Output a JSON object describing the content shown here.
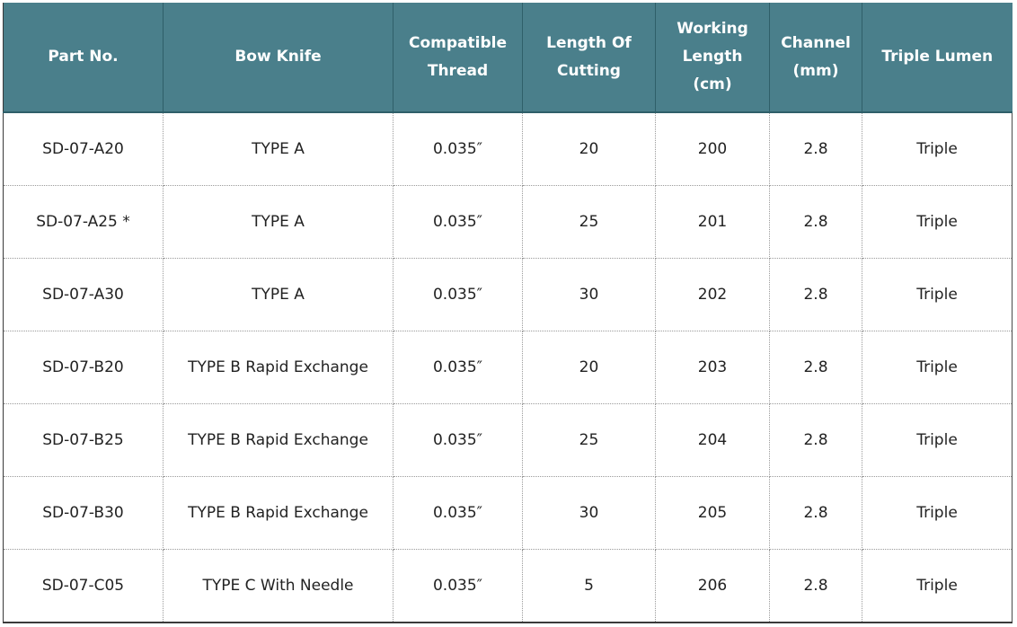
{
  "headers": [
    "Part No.",
    "Bow Knife",
    "Compatible Thread",
    "Length Of Cutting",
    "Working Length (cm)",
    "Channel (mm)",
    "Triple Lumen"
  ],
  "rows": [
    [
      "SD-07-A20",
      "TYPE A",
      "0.035″",
      "20",
      "200",
      "2.8",
      "Triple"
    ],
    [
      "SD-07-A25 *",
      "TYPE A",
      "0.035″",
      "25",
      "201",
      "2.8",
      "Triple"
    ],
    [
      "SD-07-A30",
      "TYPE A",
      "0.035″",
      "30",
      "202",
      "2.8",
      "Triple"
    ],
    [
      "SD-07-B20",
      "TYPE B Rapid Exchange",
      "0.035″",
      "20",
      "203",
      "2.8",
      "Triple"
    ],
    [
      "SD-07-B25",
      "TYPE B Rapid Exchange",
      "0.035″",
      "25",
      "204",
      "2.8",
      "Triple"
    ],
    [
      "SD-07-B30",
      "TYPE B Rapid Exchange",
      "0.035″",
      "30",
      "205",
      "2.8",
      "Triple"
    ],
    [
      "SD-07-C05",
      "TYPE C With Needle",
      "0.035″",
      "5",
      "206",
      "2.8",
      "Triple"
    ]
  ],
  "colors": {
    "header_bg": "#4a7f8b",
    "header_text": "#ffffff"
  }
}
